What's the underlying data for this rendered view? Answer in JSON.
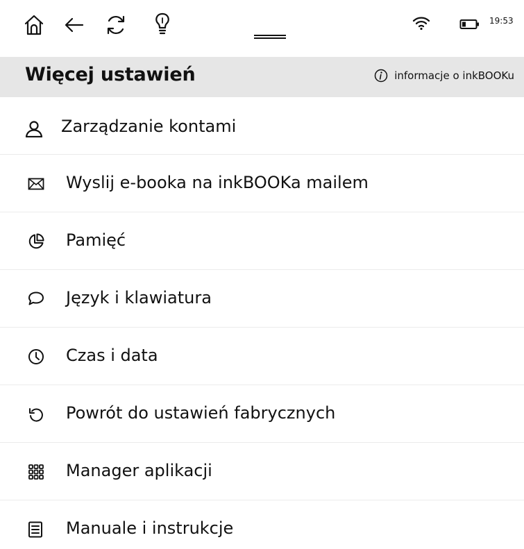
{
  "status_bar": {
    "icons": [
      "home-icon",
      "back-arrow-icon",
      "refresh-icon",
      "frontlight-bulb-icon",
      "wifi-icon",
      "battery-icon"
    ],
    "time": "19:53"
  },
  "header": {
    "title": "Więcej ustawień",
    "info_link": "informacje o inkBOOKu",
    "info_icon": "info-circle-icon",
    "background": "#e6e6e6"
  },
  "menu": {
    "items": [
      {
        "label": "Zarządzanie kontami",
        "icon": "user-icon"
      },
      {
        "label": "Wyslij e-booka na inkBOOKa mailem",
        "icon": "mail-icon"
      },
      {
        "label": "Pamięć",
        "icon": "storage-pie-icon"
      },
      {
        "label": "Język i klawiatura",
        "icon": "speech-bubble-icon"
      },
      {
        "label": "Czas i data",
        "icon": "clock-icon"
      },
      {
        "label": "Powrót do ustawień fabrycznych",
        "icon": "reset-icon"
      },
      {
        "label": "Manager aplikacji",
        "icon": "apps-grid-icon"
      },
      {
        "label": "Manuale i instrukcje",
        "icon": "document-icon"
      }
    ]
  }
}
